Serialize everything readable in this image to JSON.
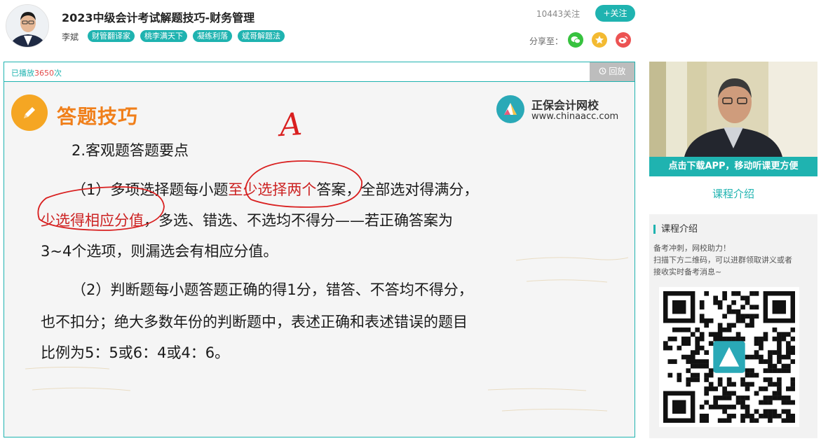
{
  "header": {
    "course_title": "2023中级会计考试解题技巧-财务管理",
    "teacher_name": "李斌",
    "tags": [
      "财管翻译家",
      "桃李满天下",
      "凝练利落",
      "斌哥解题法"
    ],
    "follow_count": "10443关注",
    "follow_button": "+关注",
    "share_label": "分享至："
  },
  "player": {
    "play_count_prefix": "已播放",
    "play_count_value": "3650",
    "play_count_suffix": "次",
    "replay_label": "回放"
  },
  "slide": {
    "title": "答题技巧",
    "brand_name": "正保会计网校",
    "brand_url": "www.chinaacc.com",
    "annotation_letter": "A",
    "heading": "2.客观题答题要点",
    "p1_line1_pre": "（1）多项选择题每小题",
    "p1_line1_highlight": "至少选择两个",
    "p1_line1_post": "答案，全部选对得满分，",
    "p1_line2_highlight": "少选得相应分值",
    "p1_line2_post": "，多选、错选、不选均不得分——若正确答案为",
    "p1_line3": "3~4个选项，则漏选会有相应分值。",
    "p2_line1": "（2）判断题每小题答题正确的得1分，错答、不答均不得分，",
    "p2_line2": "也不扣分；绝大多数年份的判断题中，表述正确和表述错误的题目",
    "p2_line3": "比例为5：5或6：4或4：6。"
  },
  "sidebar": {
    "download_bar": "点击下载APP，移动听课更方便",
    "intro_link": "课程介绍",
    "intro_heading": "课程介绍",
    "intro_lines": [
      "备考冲刺，网校助力！",
      "扫描下方二维码，可以进群领取讲义或者",
      "接收实时备考消息~"
    ]
  },
  "colors": {
    "accent": "#1fb3b0",
    "highlight_red": "#cc2222",
    "title_orange": "#f07f1a"
  }
}
